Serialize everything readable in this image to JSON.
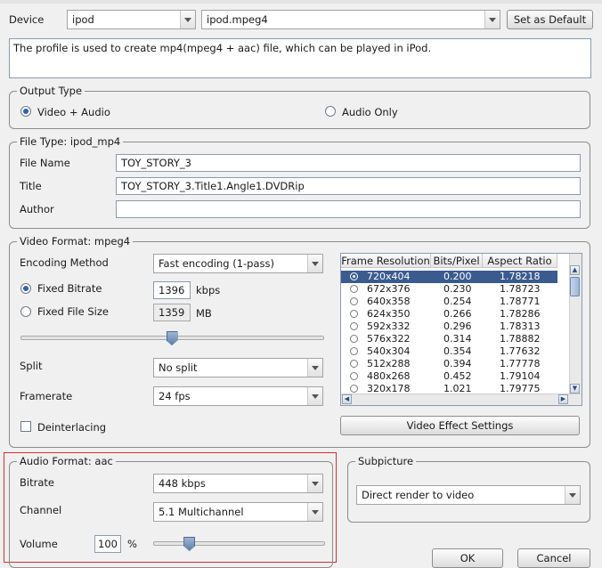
{
  "device": {
    "label": "Device",
    "device_value": "ipod",
    "profile_value": "ipod.mpeg4",
    "set_default": "Set as Default",
    "description": "The profile is used to create mp4(mpeg4 + aac) file, which can be played in iPod."
  },
  "output_type": {
    "legend": "Output Type",
    "video_audio": "Video + Audio",
    "audio_only": "Audio Only"
  },
  "file_type": {
    "legend": "File Type: ipod_mp4",
    "file_name_label": "File Name",
    "file_name": "TOY_STORY_3",
    "title_label": "Title",
    "title": "TOY_STORY_3.Title1.Angle1.DVDRip",
    "author_label": "Author",
    "author": ""
  },
  "video": {
    "legend": "Video Format: mpeg4",
    "encoding_label": "Encoding Method",
    "encoding_value": "Fast encoding (1-pass)",
    "fixed_bitrate_label": "Fixed Bitrate",
    "fixed_bitrate": "1396",
    "kbps": "kbps",
    "fixed_size_label": "Fixed File Size",
    "fixed_size": "1359",
    "mb": "MB",
    "split_label": "Split",
    "split_value": "No split",
    "framerate_label": "Framerate",
    "framerate_value": "24 fps",
    "deinterlacing": "Deinterlacing",
    "effect_button": "Video Effect Settings",
    "quality_level": 0.5
  },
  "resolution_table": {
    "headers": [
      "Frame Resolution",
      "Bits/Pixel",
      "Aspect Ratio"
    ],
    "rows": [
      [
        "720x404",
        "0.200",
        "1.78218"
      ],
      [
        "672x376",
        "0.230",
        "1.78723"
      ],
      [
        "640x358",
        "0.254",
        "1.78771"
      ],
      [
        "624x350",
        "0.266",
        "1.78286"
      ],
      [
        "592x332",
        "0.296",
        "1.78313"
      ],
      [
        "576x322",
        "0.314",
        "1.78882"
      ],
      [
        "540x304",
        "0.354",
        "1.77632"
      ],
      [
        "512x288",
        "0.394",
        "1.77778"
      ],
      [
        "480x268",
        "0.452",
        "1.79104"
      ],
      [
        "320x178",
        "1.021",
        "1.79775"
      ]
    ]
  },
  "audio": {
    "legend": "Audio Format: aac",
    "bitrate_label": "Bitrate",
    "bitrate_value": "448 kbps",
    "channel_label": "Channel",
    "channel_value": "5.1 Multichannel",
    "volume_label": "Volume",
    "volume": "100",
    "percent": "%",
    "volume_level": 0.21
  },
  "subpicture": {
    "legend": "Subpicture",
    "value": "Direct render to video"
  },
  "buttons": {
    "ok": "OK",
    "cancel": "Cancel"
  },
  "colors": {
    "highlight_border": "#d03030",
    "selection": "#3b5b8f"
  }
}
